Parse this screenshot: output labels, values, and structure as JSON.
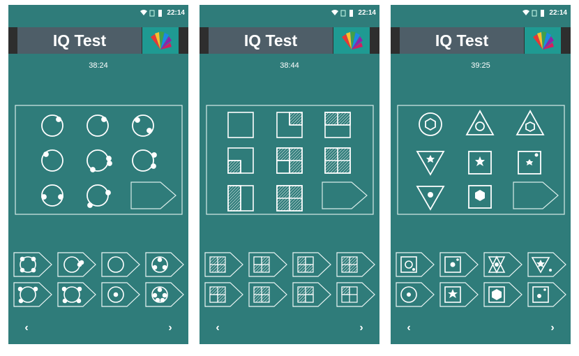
{
  "app": {
    "title": "IQ Test",
    "brand_color": "#2f7c7a",
    "panel_color": "#4e5e68"
  },
  "status_bar": {
    "time": "22:14",
    "icons": [
      "wifi-icon",
      "no-sim-icon",
      "battery-icon"
    ]
  },
  "screens": [
    {
      "timer": "38:24",
      "puzzle_theme": "circles-with-dots"
    },
    {
      "timer": "38:44",
      "puzzle_theme": "hatched-quadrant-squares"
    },
    {
      "timer": "39:25",
      "puzzle_theme": "shapes-inside-shapes"
    }
  ],
  "navigation": {
    "prev_symbol": "‹",
    "next_symbol": "›"
  }
}
